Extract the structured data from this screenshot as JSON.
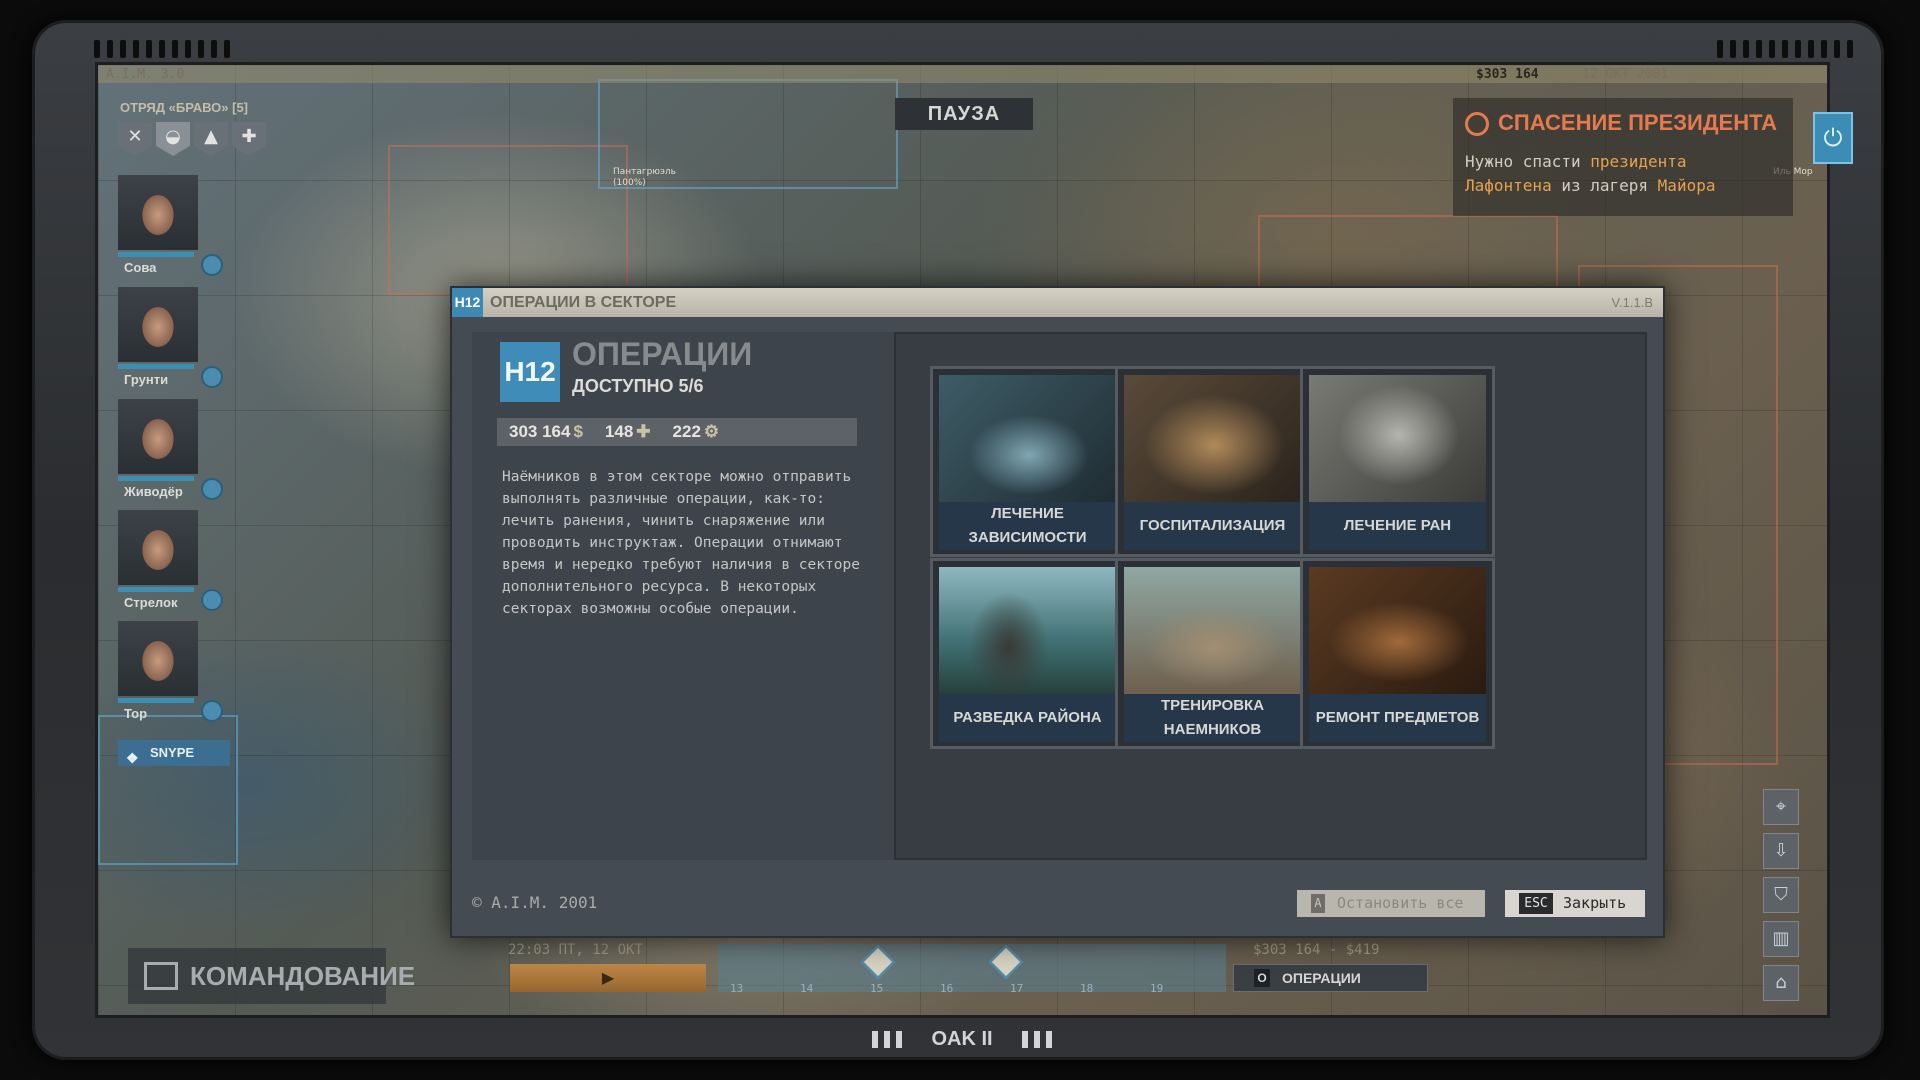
{
  "hud": {
    "top_left": "A.I.M. 3.0",
    "money": "$303 164",
    "date": "12 ОКТ 2001",
    "pause": "ПАУЗА",
    "map_label": "Пантагрюэль\n(100%)",
    "map_label_right": "Иль Мор"
  },
  "squad": {
    "title": "ОТРЯД «БРАВО» [5]",
    "mercs": [
      {
        "name": "Сова"
      },
      {
        "name": "Грунти"
      },
      {
        "name": "Живодёр"
      },
      {
        "name": "Стрелок"
      },
      {
        "name": "Тор"
      }
    ],
    "snype_label": "SNYPE"
  },
  "mission": {
    "title": "СПАСЕНИЕ ПРЕЗИДЕНТА",
    "desc_1": "Нужно спасти ",
    "desc_hl_1": "президента",
    "desc_hl_2": "Лафонтена",
    "desc_2": " из лагеря ",
    "desc_hl_3": "Майора"
  },
  "command": {
    "label": "КОМАНДОВАНИЕ"
  },
  "timeline": {
    "time": "22:03 ПТ, 12 ОКТ",
    "ticks": [
      "13",
      "14",
      "15",
      "16",
      "17",
      "18",
      "19"
    ],
    "money_range": "$303 164 - $419",
    "ops_key": "O",
    "ops_label": "ОПЕРАЦИИ"
  },
  "footer": {
    "brand": "OAK II"
  },
  "modal": {
    "sector_tag": "H12",
    "title": "ОПЕРАЦИИ В СЕКТОРЕ",
    "version": "V.1.1.B",
    "sector_badge": "H12",
    "ops_title": "ОПЕРАЦИИ",
    "available": "ДОСТУПНО 5/6",
    "resources": {
      "money": "303 164",
      "medicine": "148",
      "parts": "222"
    },
    "description": "Наёмников в этом секторе можно отправить выполнять различные операции, как-то: лечить ранения, чинить снаряжение или проводить инструктаж. Операции отнимают время и нередко требуют наличия в секторе дополнительного ресурса. В некоторых секторах возможны особые операции.",
    "operations": [
      {
        "label_1": "ЛЕЧЕНИЕ",
        "label_2": "ЗАВИСИМОСТИ"
      },
      {
        "label_1": "ГОСПИТАЛИЗАЦИЯ",
        "label_2": ""
      },
      {
        "label_1": "ЛЕЧЕНИЕ РАН",
        "label_2": ""
      },
      {
        "label_1": "РАЗВЕДКА РАЙОНА",
        "label_2": ""
      },
      {
        "label_1": "ТРЕНИРОВКА",
        "label_2": "НАЕМНИКОВ"
      },
      {
        "label_1": "РЕМОНТ ПРЕДМЕТОВ",
        "label_2": ""
      }
    ],
    "copyright": "© A.I.M. 2001",
    "stop_key": "A",
    "stop_label": "Остановить все",
    "close_key": "ESC",
    "close_label": "Закрыть"
  },
  "colors": {
    "accent": "#3f8cb8",
    "mission": "#e57a4f",
    "highlight": "#e6a24f"
  }
}
